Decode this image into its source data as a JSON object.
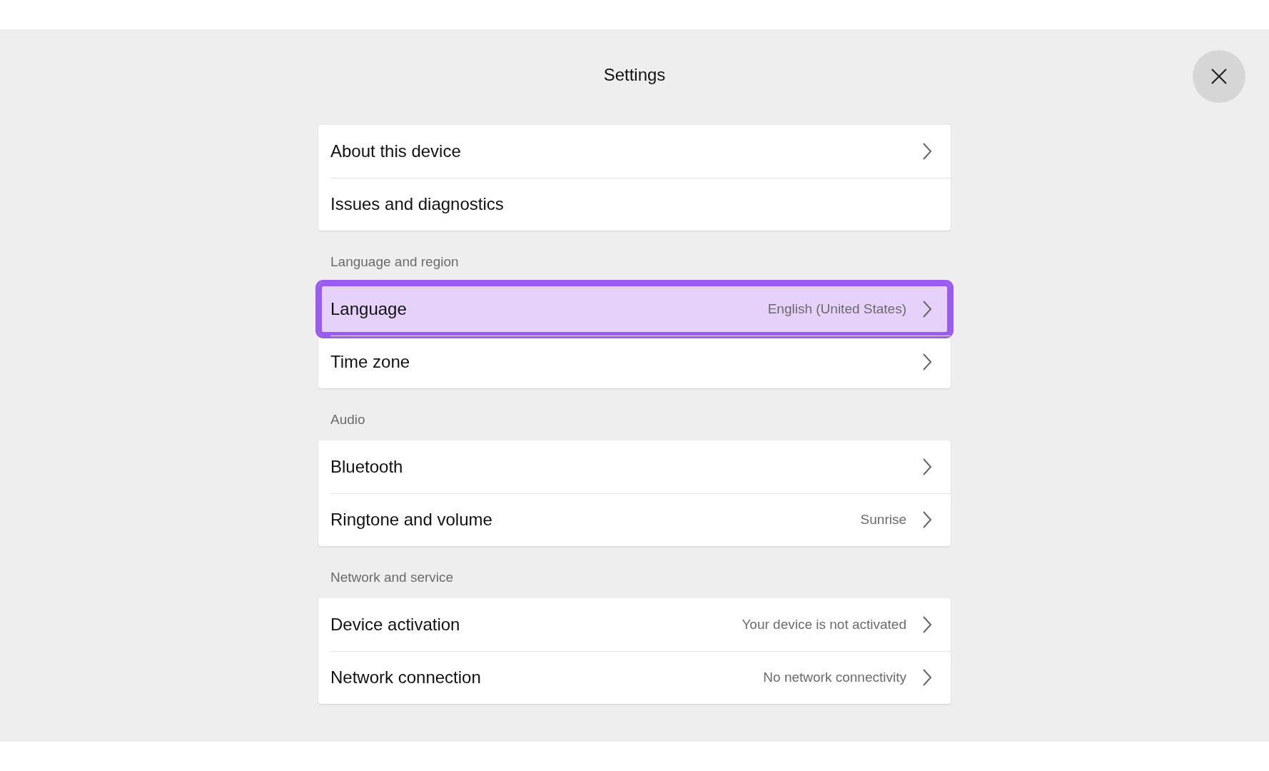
{
  "title": "Settings",
  "sections": [
    {
      "items": [
        {
          "label": "About this device",
          "chevron": true,
          "selected": false
        },
        {
          "label": "Issues and diagnostics",
          "chevron": false,
          "selected": false
        }
      ]
    },
    {
      "heading": "Language and region",
      "items": [
        {
          "label": "Language",
          "value": "English (United States)",
          "chevron": true,
          "selected": true
        },
        {
          "label": "Time zone",
          "chevron": true,
          "selected": false
        }
      ]
    },
    {
      "heading": "Audio",
      "items": [
        {
          "label": "Bluetooth",
          "chevron": true,
          "selected": false
        },
        {
          "label": "Ringtone and volume",
          "value": "Sunrise",
          "chevron": true,
          "selected": false
        }
      ]
    },
    {
      "heading": "Network and service",
      "items": [
        {
          "label": "Device activation",
          "value": "Your device is not activated",
          "chevron": true,
          "selected": false
        },
        {
          "label": "Network connection",
          "value": "No network connectivity",
          "chevron": true,
          "selected": false
        }
      ]
    }
  ]
}
